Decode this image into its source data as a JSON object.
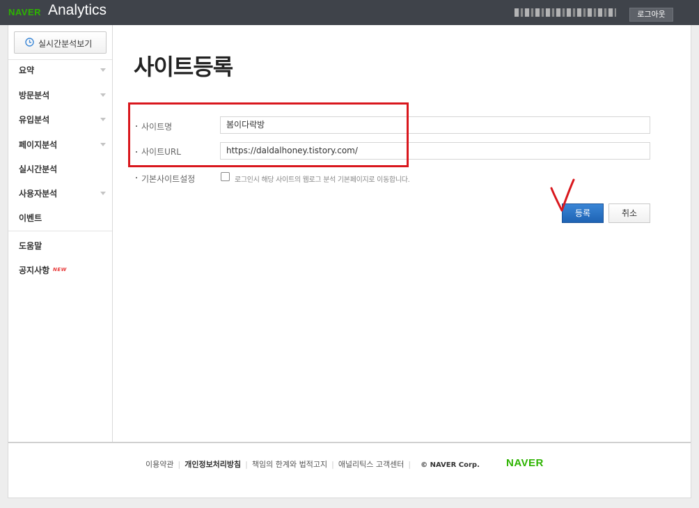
{
  "header": {
    "brand": "NAVER",
    "product": "Analytics",
    "logout_label": "로그아웃"
  },
  "sidebar": {
    "realtime_button": "실시간분석보기",
    "items": [
      {
        "label": "요약",
        "has_arrow": true
      },
      {
        "label": "방문분석",
        "has_arrow": true
      },
      {
        "label": "유입분석",
        "has_arrow": true
      },
      {
        "label": "페이지분석",
        "has_arrow": true
      },
      {
        "label": "실시간분석",
        "has_arrow": false
      },
      {
        "label": "사용자분석",
        "has_arrow": true
      },
      {
        "label": "이벤트",
        "has_arrow": false
      },
      {
        "label": "도움말",
        "has_arrow": false
      },
      {
        "label": "공지사항",
        "has_arrow": false
      }
    ],
    "new_badge": "NEW"
  },
  "main": {
    "title": "사이트등록",
    "form": {
      "site_name_label": "사이트명",
      "site_name_value": "봄이다락방",
      "site_url_label": "사이트URL",
      "site_url_value": "https://daldalhoney.tistory.com/",
      "default_site_label": "기본사이트설정",
      "default_site_checked": false,
      "default_site_description": "로그인시 해당 사이트의 웹로그 분석 기본페이지로 이동합니다."
    },
    "buttons": {
      "register": "등록",
      "cancel": "취소"
    },
    "colors": {
      "highlight": "#d9171d",
      "primary_button": "#1e63b4",
      "brand_green": "#2db400"
    }
  },
  "footer": {
    "links": [
      "이용약관",
      "개인정보처리방침",
      "책임의 한계와 법적고지",
      "애널리틱스 고객센터"
    ],
    "copyright": "© NAVER Corp.",
    "logo": "NAVER"
  }
}
